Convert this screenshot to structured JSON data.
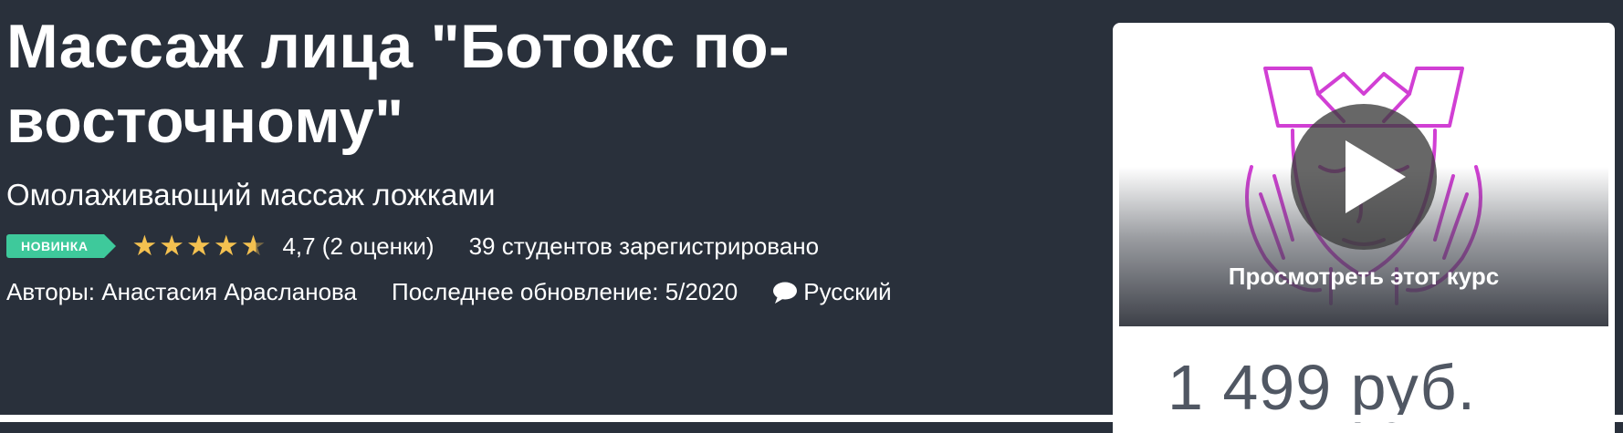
{
  "course": {
    "title": "Массаж лица \"Ботокс по-восточному\"",
    "subtitle": "Омолаживающий массаж ложками",
    "badge": "НОВИНКА",
    "rating": {
      "value": 4.7,
      "stars_text": "4,7 (2 оценки)",
      "max": 5
    },
    "students": "39 студентов зарегистрировано",
    "authors": "Авторы: Анастасия Арасланова",
    "updated": "Последнее обновление: 5/2020",
    "language": "Русский"
  },
  "sidebar": {
    "preview_label": "Просмотреть этот курс",
    "price": "1 499 руб."
  },
  "colors": {
    "background": "#29303b",
    "badge": "#3ec99b",
    "star": "#f4c150",
    "illustration": "#d13fd4",
    "price": "#505763"
  },
  "icons": {
    "language": "speech-bubble-icon",
    "preview": "play-icon",
    "rating": "star-icon"
  }
}
